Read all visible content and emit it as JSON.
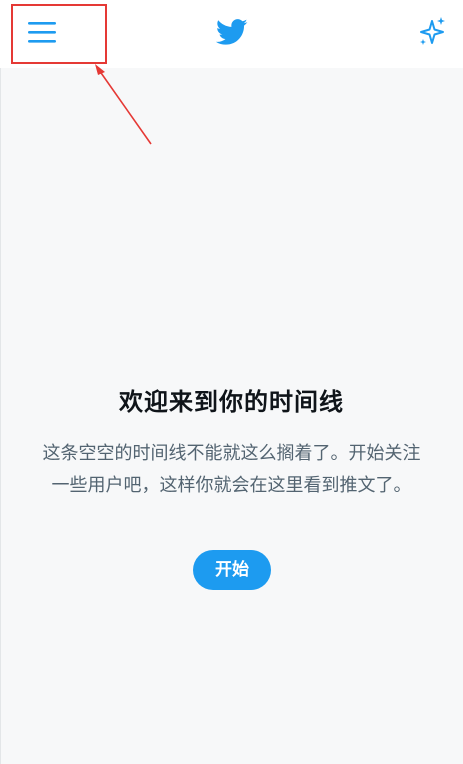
{
  "header": {
    "menu_icon": "hamburger-menu-icon",
    "logo_icon": "twitter-bird-icon",
    "sparkle_icon": "sparkle-icon"
  },
  "colors": {
    "accent": "#1d9bf0",
    "annotation": "#e53935",
    "title": "#0f1419",
    "secondary_text": "#536471"
  },
  "main": {
    "title": "欢迎来到你的时间线",
    "description": "这条空空的时间线不能就这么搁着了。开始关注一些用户吧，这样你就会在这里看到推文了。",
    "start_button": "开始"
  }
}
